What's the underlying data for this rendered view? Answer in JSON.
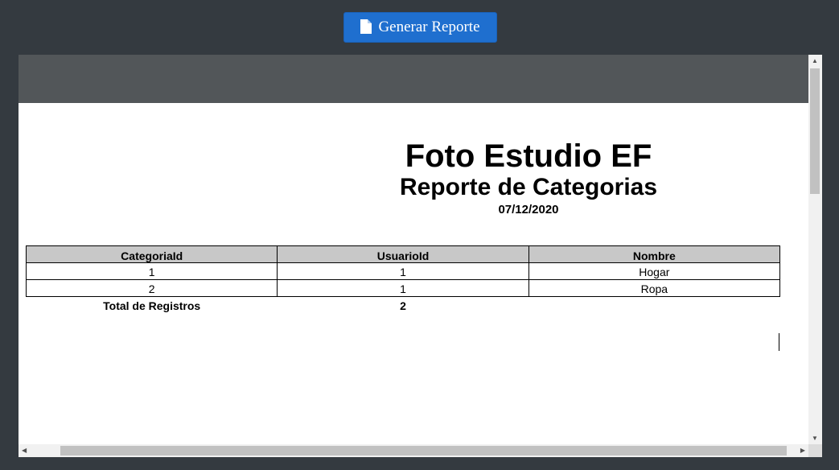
{
  "toolbar": {
    "generate_button_label": "Generar Reporte",
    "generate_button_icon": "file-icon",
    "button_color": "#1f6fcf"
  },
  "report": {
    "title": "Foto Estudio EF",
    "subtitle": "Reporte de Categorias",
    "date": "07/12/2020",
    "columns": [
      "CategoriaId",
      "UsuarioId",
      "Nombre"
    ],
    "rows": [
      [
        "1",
        "1",
        "Hogar"
      ],
      [
        "2",
        "1",
        "Ropa"
      ]
    ],
    "total_label": "Total de Registros",
    "total_value": "2"
  },
  "viewer": {
    "toolbar_color": "#525659"
  }
}
